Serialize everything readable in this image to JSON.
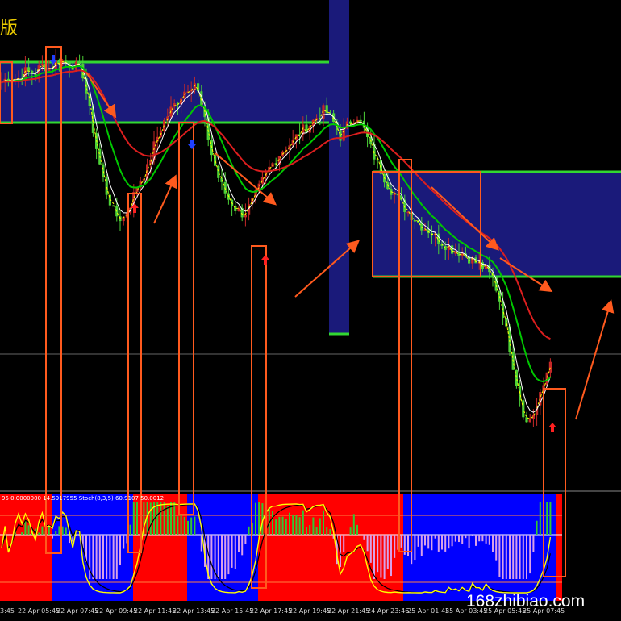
{
  "chart_data": {
    "type": "line",
    "title_fragment": "版",
    "watermark": "168zhibiao.com",
    "indicator_header": "95 0.0000000 14.5917955  Stoch(8,3,5) 60.9107 50.0012",
    "x_tick_labels": [
      "3:45",
      "22 Apr 05:45",
      "22 Apr 07:45",
      "22 Apr 09:45",
      "22 Apr 11:45",
      "22 Apr 13:45",
      "22 Apr 15:45",
      "22 Apr 17:45",
      "22 Apr 19:45",
      "22 Apr 21:45",
      "24 Apr 23:46",
      "25 Apr 01:45",
      "25 Apr 03:45",
      "25 Apr 05:45",
      "25 Apr 07:45"
    ],
    "price_series_close": [
      62,
      64,
      63,
      66,
      65,
      68,
      67,
      70,
      69,
      68,
      66,
      50,
      34,
      22,
      14,
      12,
      18,
      26,
      30,
      40,
      47,
      52,
      56,
      60,
      62,
      50,
      36,
      26,
      20,
      16,
      14,
      18,
      24,
      30,
      34,
      38,
      40,
      44,
      46,
      49,
      52,
      48,
      42,
      47,
      50,
      44,
      36,
      30,
      24,
      20,
      16,
      13,
      10,
      8,
      5,
      3,
      1,
      0,
      -2,
      -4,
      -6,
      -10,
      -20,
      -35,
      -50,
      -62,
      -58,
      -50,
      -38
    ],
    "series": [
      {
        "name": "ma-white",
        "color": "#ffffff"
      },
      {
        "name": "ma-green",
        "color": "#00c800"
      },
      {
        "name": "ma-red",
        "color": "#dc1e1e"
      },
      {
        "name": "stoch-main",
        "color": "#ffff00"
      },
      {
        "name": "stoch-signal",
        "color": "#000000"
      }
    ],
    "colors": {
      "up_candle": "#4cd137",
      "down_candle": "#c62828",
      "zone_fill": "#1a1a7a",
      "zone_border": "#32d732",
      "box_border": "#ff5a1e",
      "arrow": "#ff5a1e",
      "signal_up": "#ff2020",
      "signal_down": "#2040ff",
      "indicator_blue": "#0000ff",
      "indicator_red": "#ff0000",
      "hist_up": "#32c832",
      "hist_down": "#d8a0e8"
    }
  }
}
